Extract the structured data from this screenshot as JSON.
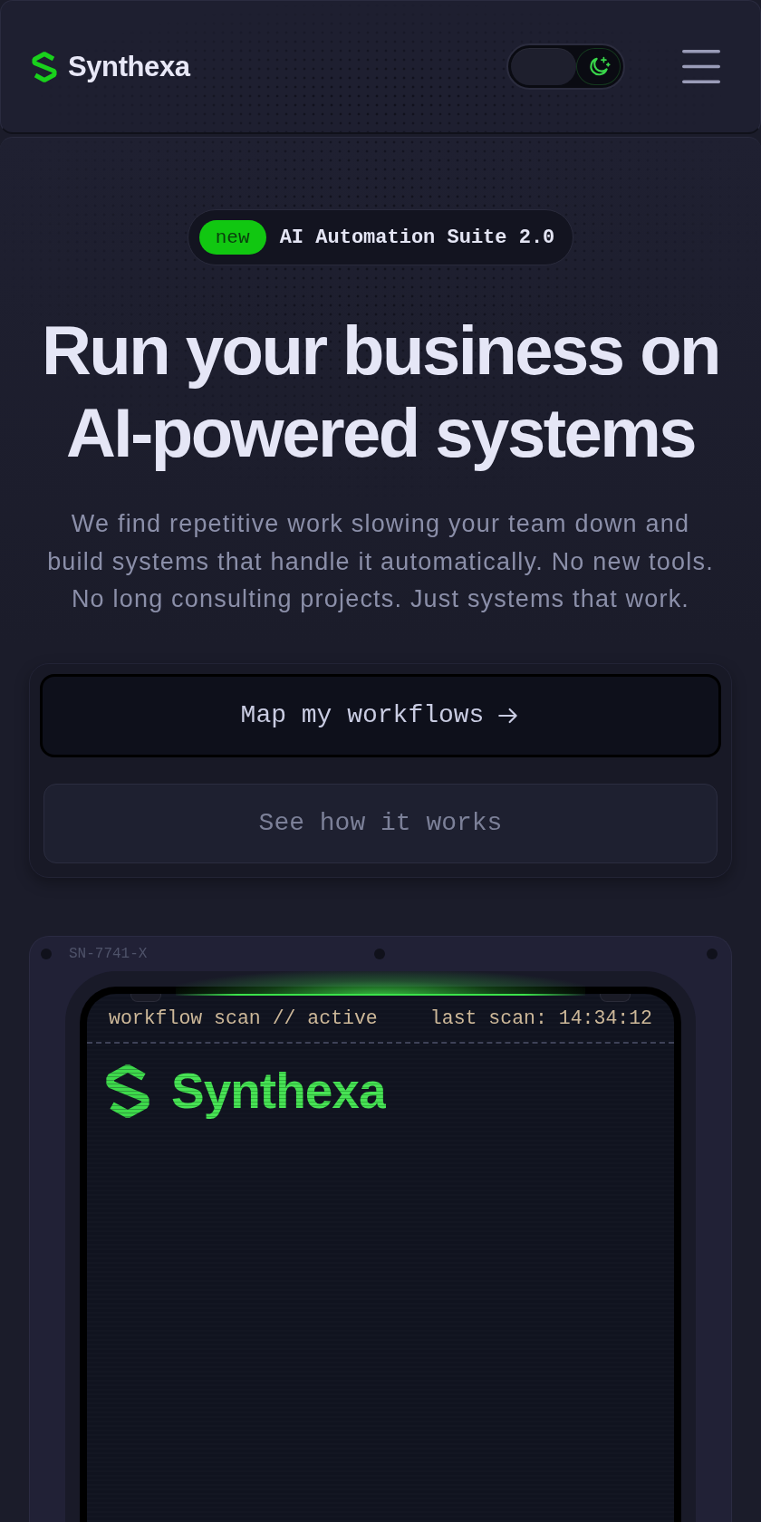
{
  "header": {
    "brand": "Synthexa",
    "theme_toggle": {
      "on": true
    }
  },
  "hero": {
    "badge": {
      "tag": "new",
      "text": "AI Automation Suite 2.0"
    },
    "title": "Run your business on AI-powered systems",
    "subtitle": "We find repetitive work slowing your team down and build systems that handle it automatically. No new tools. No long consulting projects. Just systems that work.",
    "buttons": [
      {
        "kind": "primary",
        "label": "Map my workflows"
      },
      {
        "kind": "secondary",
        "label": "See how it works"
      }
    ]
  },
  "device": {
    "serial": "SN-7741-X",
    "screen": {
      "status": "workflow scan // active",
      "last_scan": "last scan: 14:34:12",
      "brand": "Synthexa"
    }
  }
}
